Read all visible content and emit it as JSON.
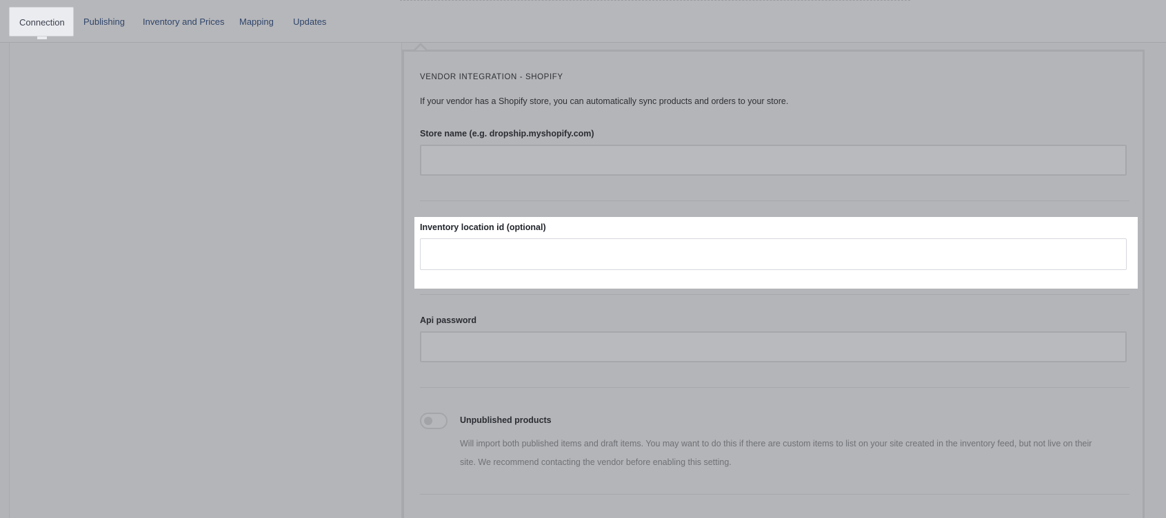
{
  "tabs": [
    {
      "label": "Connection",
      "active": true
    },
    {
      "label": "Publishing",
      "active": false
    },
    {
      "label": "Inventory and Prices",
      "active": false
    },
    {
      "label": "Mapping",
      "active": false
    },
    {
      "label": "Updates",
      "active": false
    }
  ],
  "section": {
    "title": "VENDOR INTEGRATION - SHOPIFY",
    "description": "If your vendor has a Shopify store, you can automatically sync products and orders to your store."
  },
  "fields": {
    "store_name": {
      "label": "Store name (e.g. dropship.myshopify.com)",
      "value": ""
    },
    "inventory_location": {
      "label": "Inventory location id (optional)",
      "value": ""
    },
    "api_password": {
      "label": "Api password",
      "value": ""
    }
  },
  "unpublished_toggle": {
    "label": "Unpublished products",
    "enabled": false,
    "description": "Will import both published items and draft items. You may want to do this if there are custom items to list on your site created in the inventory feed, but not live on their site. We recommend contacting the vendor before enabling this setting."
  },
  "colors": {
    "overlay": "#b3b4b7",
    "tab_text": "#2f456b",
    "spotlight": "#ffffff"
  }
}
